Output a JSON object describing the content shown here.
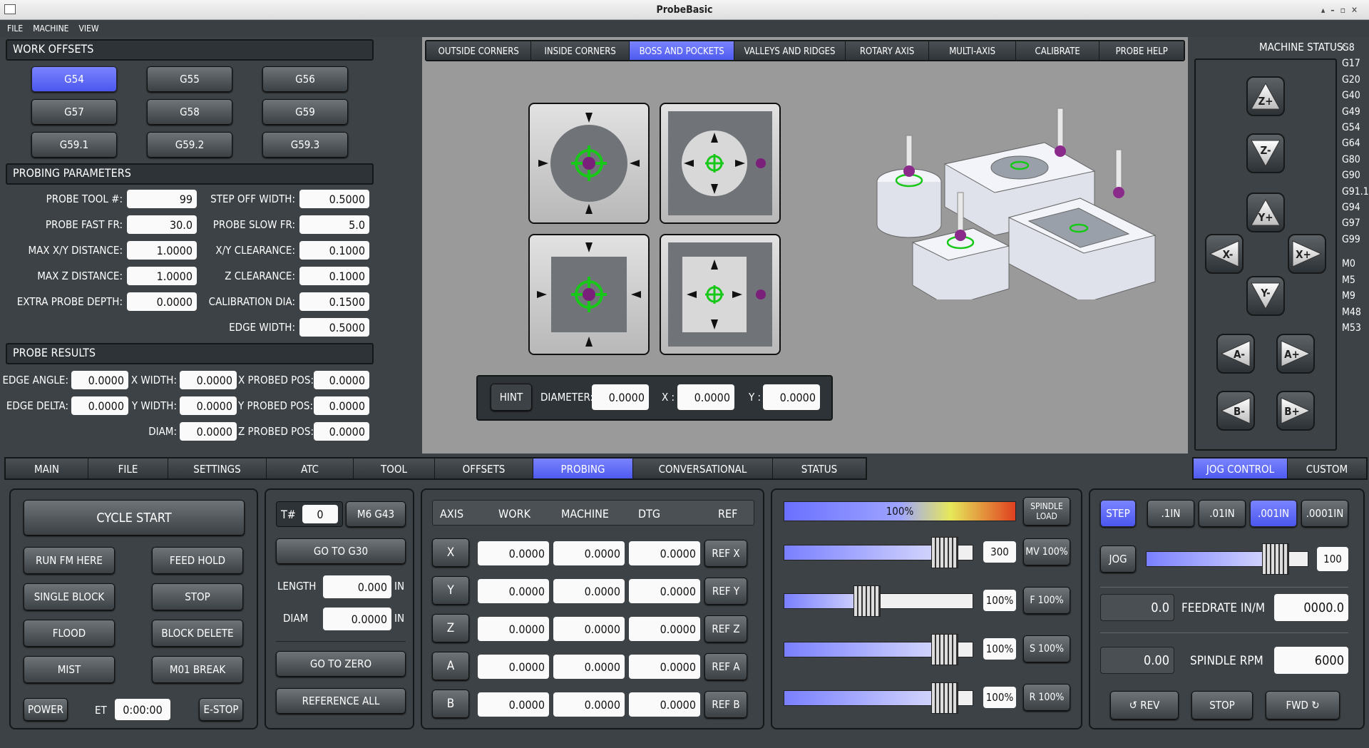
{
  "window": {
    "title": "ProbeBasic"
  },
  "menu": [
    "FILE",
    "MACHINE",
    "VIEW"
  ],
  "work_offsets": {
    "header": "WORK OFFSETS",
    "buttons": [
      "G54",
      "G55",
      "G56",
      "G57",
      "G58",
      "G59",
      "G59.1",
      "G59.2",
      "G59.3"
    ],
    "selected": "G54"
  },
  "probing_params": {
    "header": "PROBING PARAMETERS",
    "left": [
      {
        "label": "PROBE TOOL #:",
        "value": "99"
      },
      {
        "label": "PROBE FAST FR:",
        "value": "30.0"
      },
      {
        "label": "MAX X/Y DISTANCE:",
        "value": "1.0000"
      },
      {
        "label": "MAX Z DISTANCE:",
        "value": "1.0000"
      },
      {
        "label": "EXTRA PROBE DEPTH:",
        "value": "0.0000"
      }
    ],
    "right": [
      {
        "label": "STEP OFF WIDTH:",
        "value": "0.5000"
      },
      {
        "label": "PROBE SLOW FR:",
        "value": "5.0"
      },
      {
        "label": "X/Y CLEARANCE:",
        "value": "0.1000"
      },
      {
        "label": "Z CLEARANCE:",
        "value": "0.1000"
      },
      {
        "label": "CALIBRATION DIA:",
        "value": "0.1500"
      },
      {
        "label": "EDGE WIDTH:",
        "value": "0.5000"
      }
    ]
  },
  "probe_results": {
    "header": "PROBE RESULTS",
    "col1": [
      {
        "label": "EDGE ANGLE:",
        "value": "0.0000"
      },
      {
        "label": "EDGE DELTA:",
        "value": "0.0000"
      }
    ],
    "col2": [
      {
        "label": "X WIDTH:",
        "value": "0.0000"
      },
      {
        "label": "Y WIDTH:",
        "value": "0.0000"
      },
      {
        "label": "DIAM:",
        "value": "0.0000"
      }
    ],
    "col3": [
      {
        "label": "X PROBED POS:",
        "value": "0.0000"
      },
      {
        "label": "Y PROBED POS:",
        "value": "0.0000"
      },
      {
        "label": "Z PROBED POS:",
        "value": "0.0000"
      }
    ]
  },
  "probe_tabs": {
    "items": [
      "OUTSIDE CORNERS",
      "INSIDE CORNERS",
      "BOSS AND POCKETS",
      "VALLEYS AND RIDGES",
      "ROTARY AXIS",
      "MULTI-AXIS",
      "CALIBRATE",
      "PROBE HELP"
    ],
    "selected": "BOSS AND POCKETS"
  },
  "hint_bar": {
    "hint": "HINT",
    "diameter_label": "DIAMETER:",
    "diameter": "0.0000",
    "x_label": "X :",
    "x": "0.0000",
    "y_label": "Y :",
    "y": "0.0000"
  },
  "machine_status": {
    "label": "MACHINE STATUS:",
    "gcodes": [
      "G8",
      "G17",
      "G20",
      "G40",
      "G49",
      "G54",
      "G64",
      "G80",
      "G90",
      "G91.1",
      "G94",
      "G97",
      "G99"
    ],
    "mcodes": [
      "M0",
      "M5",
      "M9",
      "M48",
      "M53"
    ]
  },
  "jog_buttons": [
    "Z+",
    "Z-",
    "Y+",
    "X-",
    "X+",
    "Y-",
    "A-",
    "A+",
    "B-",
    "B+"
  ],
  "main_tabs": {
    "items": [
      "MAIN",
      "FILE",
      "SETTINGS",
      "ATC",
      "TOOL",
      "OFFSETS",
      "PROBING",
      "CONVERSATIONAL",
      "STATUS"
    ],
    "selected": "PROBING"
  },
  "right_tabs": {
    "items": [
      "JOG CONTROL",
      "CUSTOM"
    ],
    "selected": "JOG CONTROL"
  },
  "control": {
    "cycle_start": "CYCLE START",
    "run_from_here": "RUN FM HERE",
    "feed_hold": "FEED HOLD",
    "single_block": "SINGLE BLOCK",
    "stop": "STOP",
    "flood": "FLOOD",
    "block_delete": "BLOCK DELETE",
    "mist": "MIST",
    "m01_break": "M01 BREAK",
    "power": "POWER",
    "et_label": "ET",
    "et_value": "0:00:00",
    "estop": "E-STOP"
  },
  "tool": {
    "t_label": "T#",
    "t_value": "0",
    "m6g43": "M6 G43",
    "go_g30": "GO TO G30",
    "length_label": "LENGTH",
    "length": "0.000",
    "diam_label": "DIAM",
    "diam": "0.0000",
    "unit": "IN",
    "go_zero": "GO TO ZERO",
    "ref_all": "REFERENCE ALL"
  },
  "dro": {
    "headers": [
      "AXIS",
      "WORK",
      "MACHINE",
      "DTG",
      "REF"
    ],
    "rows": [
      {
        "axis": "X",
        "work": "0.0000",
        "machine": "0.0000",
        "dtg": "0.0000",
        "ref": "REF X"
      },
      {
        "axis": "Y",
        "work": "0.0000",
        "machine": "0.0000",
        "dtg": "0.0000",
        "ref": "REF Y"
      },
      {
        "axis": "Z",
        "work": "0.0000",
        "machine": "0.0000",
        "dtg": "0.0000",
        "ref": "REF Z"
      },
      {
        "axis": "A",
        "work": "0.0000",
        "machine": "0.0000",
        "dtg": "0.0000",
        "ref": "REF A"
      },
      {
        "axis": "B",
        "work": "0.0000",
        "machine": "0.0000",
        "dtg": "0.0000",
        "ref": "REF B"
      }
    ]
  },
  "overrides": {
    "spindle_load": "100%",
    "spindle_load_level": 1.0,
    "spindle_load_label": "SPINDLE LOAD",
    "rows": [
      {
        "value": "300",
        "button": "MV 100%",
        "level": 0.85
      },
      {
        "value": "100%",
        "button": "F 100%",
        "level": 0.44
      },
      {
        "value": "100%",
        "button": "S 100%",
        "level": 0.85
      },
      {
        "value": "100%",
        "button": "R 100%",
        "level": 0.85
      }
    ]
  },
  "jog_control": {
    "step": "STEP",
    "increments": [
      ".1IN",
      ".01IN",
      ".001IN",
      ".0001IN"
    ],
    "selected": ".001IN",
    "jog": "JOG",
    "jog_value": "100",
    "jog_level": 0.8,
    "feed_actual": "0.0",
    "feed_label": "FEEDRATE IN/M",
    "feed_set": "0000.0",
    "rpm_actual": "0.00",
    "rpm_label": "SPINDLE RPM",
    "rpm_set": "6000",
    "rev": "REV",
    "stop": "STOP",
    "fwd": "FWD"
  },
  "colors": {
    "accent": "#5560f5",
    "bg": "#3c4246",
    "panel_dark": "#2e3337",
    "probe_green": "#18c818",
    "probe_ball": "#7a1f7a"
  }
}
